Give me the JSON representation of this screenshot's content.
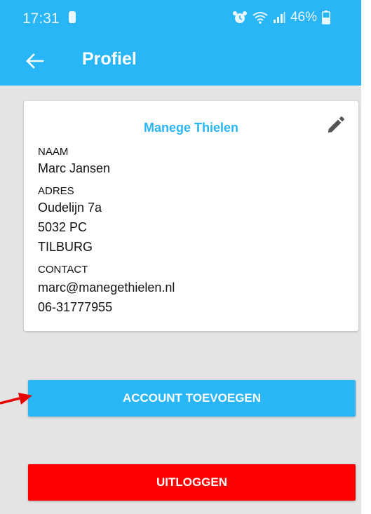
{
  "status_bar": {
    "time": "17:31",
    "battery": "46%",
    "icons": [
      "sim-icon",
      "alarm-icon",
      "wifi-icon",
      "signal-icon",
      "battery-icon"
    ]
  },
  "app_bar": {
    "title": "Profiel",
    "back_icon": "arrow-left-icon"
  },
  "profile": {
    "title": "Manege Thielen",
    "edit_icon": "pencil-icon",
    "name_label": "NAAM",
    "name": "Marc Jansen",
    "address_label": "ADRES",
    "street": "Oudelijn 7a",
    "postcode": "5032 PC",
    "city": "TILBURG",
    "contact_label": "CONTACT",
    "email": "marc@manegethielen.nl",
    "phone": "06-31777955"
  },
  "actions": {
    "add_account": "ACCOUNT TOEVOEGEN",
    "logout": "UITLOGGEN"
  },
  "colors": {
    "primary": "#29b6f6",
    "danger": "#ff0000",
    "annotation_arrow": "#e60000",
    "background": "#e4e4e4"
  }
}
